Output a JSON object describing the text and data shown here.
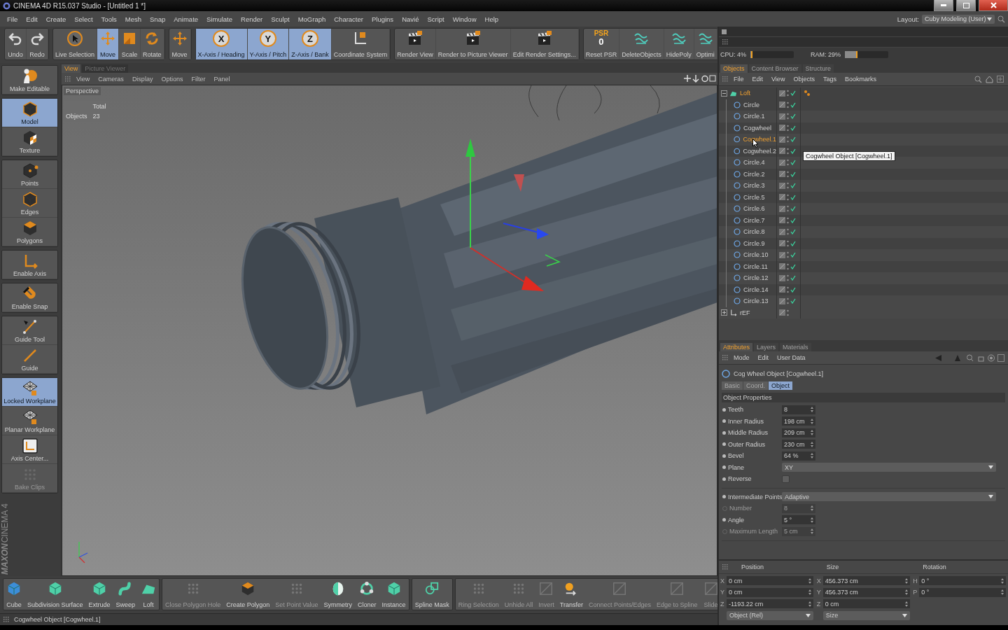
{
  "window": {
    "title": "CINEMA 4D R15.037 Studio - [Untitled 1 *]"
  },
  "menu": [
    "File",
    "Edit",
    "Create",
    "Select",
    "Tools",
    "Mesh",
    "Snap",
    "Animate",
    "Simulate",
    "Render",
    "Sculpt",
    "MoGraph",
    "Character",
    "Plugins",
    "Navié",
    "Script",
    "Window",
    "Help"
  ],
  "layout": {
    "label": "Layout:",
    "value": "Cuby Modeling (User)"
  },
  "toolbar": [
    [
      {
        "label": "Undo",
        "selected": false
      },
      {
        "label": "Redo",
        "selected": false
      }
    ],
    [
      {
        "label": "Live Selection",
        "selected": false
      },
      {
        "label": "Move",
        "selected": true
      },
      {
        "label": "Scale",
        "selected": false
      },
      {
        "label": "Rotate",
        "selected": false
      }
    ],
    [
      {
        "label": "Move",
        "selected": false
      }
    ],
    [
      {
        "label": "X-Axis / Heading",
        "selected": true,
        "glyph": "X"
      },
      {
        "label": "Y-Axis / Pitch",
        "selected": true,
        "glyph": "Y"
      },
      {
        "label": "Z-Axis / Bank",
        "selected": true,
        "glyph": "Z"
      },
      {
        "label": "Coordinate System",
        "selected": false
      }
    ],
    [
      {
        "label": "Render View",
        "selected": false
      },
      {
        "label": "Render to Picture Viewer",
        "selected": false
      },
      {
        "label": "Edit Render Settings...",
        "selected": false
      }
    ],
    [
      {
        "label": "Reset PSR",
        "selected": false,
        "glyph": "PSR",
        "glyph2": "0"
      },
      {
        "label": "DeleteObjects",
        "selected": false
      },
      {
        "label": "HidePoly",
        "selected": false
      },
      {
        "label": "Optimi",
        "selected": false
      }
    ]
  ],
  "meters": [
    {
      "label": "CPU: 4%",
      "level": 0.04
    },
    {
      "label": "RAM: 29%",
      "level": 0.29
    }
  ],
  "palette": [
    [
      {
        "label": "Make Editable",
        "selected": false,
        "disabled": false
      }
    ],
    [
      {
        "label": "Model",
        "selected": true,
        "disabled": false
      },
      {
        "label": "Texture",
        "selected": false,
        "disabled": false
      }
    ],
    [
      {
        "label": "Points",
        "selected": false,
        "disabled": false
      },
      {
        "label": "Edges",
        "selected": false,
        "disabled": false
      },
      {
        "label": "Polygons",
        "selected": false,
        "disabled": false
      }
    ],
    [
      {
        "label": "Enable Axis",
        "selected": false,
        "disabled": false
      }
    ],
    [
      {
        "label": "Enable Snap",
        "selected": false,
        "disabled": false
      }
    ],
    [
      {
        "label": "Guide Tool",
        "selected": false,
        "disabled": false
      },
      {
        "label": "Guide",
        "selected": false,
        "disabled": false
      }
    ],
    [
      {
        "label": "Locked Workplane",
        "selected": true,
        "disabled": false
      },
      {
        "label": "Planar Workplane",
        "selected": false,
        "disabled": false
      },
      {
        "label": "Axis Center...",
        "selected": false,
        "disabled": false
      },
      {
        "label": "Bake Clips",
        "selected": false,
        "disabled": true
      }
    ]
  ],
  "logo": {
    "brand": "MAXON",
    "product": "CINEMA 4"
  },
  "viewport": {
    "tabs": [
      {
        "label": "View",
        "selected": true
      },
      {
        "label": "Picture Viewer",
        "selected": false
      }
    ],
    "menu": [
      "View",
      "Cameras",
      "Display",
      "Options",
      "Filter",
      "Panel"
    ],
    "camera": "Perspective",
    "stats": {
      "header": "Total",
      "label": "Objects",
      "value": "23"
    }
  },
  "objects": {
    "tabs": [
      {
        "label": "Objects",
        "selected": true
      },
      {
        "label": "Content Browser",
        "selected": false
      },
      {
        "label": "Structure",
        "selected": false
      }
    ],
    "menu": [
      "File",
      "Edit",
      "View",
      "Objects",
      "Tags",
      "Bookmarks"
    ],
    "tree": [
      {
        "name": "Loft",
        "selected": true,
        "expanded": true,
        "checked": true,
        "children": [
          {
            "name": "Circle",
            "selected": false,
            "checked": true
          },
          {
            "name": "Circle.1",
            "selected": false,
            "checked": true
          },
          {
            "name": "Cogwheel",
            "selected": false,
            "checked": true
          },
          {
            "name": "Cogwheel.1",
            "selected": true,
            "checked": true
          },
          {
            "name": "Cogwheel.2",
            "selected": false,
            "checked": true
          },
          {
            "name": "Circle.4",
            "selected": false,
            "checked": true
          },
          {
            "name": "Circle.2",
            "selected": false,
            "checked": true
          },
          {
            "name": "Circle.3",
            "selected": false,
            "checked": true
          },
          {
            "name": "Circle.5",
            "selected": false,
            "checked": true
          },
          {
            "name": "Circle.6",
            "selected": false,
            "checked": true
          },
          {
            "name": "Circle.7",
            "selected": false,
            "checked": true
          },
          {
            "name": "Circle.8",
            "selected": false,
            "checked": true
          },
          {
            "name": "Circle.9",
            "selected": false,
            "checked": true
          },
          {
            "name": "Circle.10",
            "selected": false,
            "checked": true
          },
          {
            "name": "Circle.11",
            "selected": false,
            "checked": true
          },
          {
            "name": "Circle.12",
            "selected": false,
            "checked": true
          },
          {
            "name": "Circle.14",
            "selected": false,
            "checked": true
          },
          {
            "name": "Circle.13",
            "selected": false,
            "checked": true
          }
        ]
      },
      {
        "name": "rEF",
        "selected": false,
        "expanded": false,
        "checked": false
      }
    ],
    "tooltip": "Cogwheel Object [Cogwheel.1]"
  },
  "attributes": {
    "tabs": [
      {
        "label": "Attributes",
        "selected": true
      },
      {
        "label": "Layers",
        "selected": false
      },
      {
        "label": "Materials",
        "selected": false
      }
    ],
    "menu": [
      "Mode",
      "Edit",
      "User Data"
    ],
    "title": "Cog Wheel Object [Cogwheel.1]",
    "subtabs": [
      {
        "label": "Basic",
        "selected": false
      },
      {
        "label": "Coord.",
        "selected": false
      },
      {
        "label": "Object",
        "selected": true
      }
    ],
    "section": "Object Properties",
    "properties": [
      [
        {
          "label": "Teeth",
          "kind": "number",
          "value": "8",
          "disabled": false
        },
        {
          "label": "Inner Radius",
          "kind": "number",
          "value": "198 cm",
          "disabled": false
        },
        {
          "label": "Middle Radius",
          "kind": "number",
          "value": "209 cm",
          "disabled": false
        },
        {
          "label": "Outer Radius",
          "kind": "number",
          "value": "230 cm",
          "disabled": false
        },
        {
          "label": "Bevel",
          "kind": "number",
          "value": "64 %",
          "disabled": false
        },
        {
          "label": "Plane",
          "kind": "dropdown",
          "value": "XY",
          "disabled": false
        },
        {
          "label": "Reverse",
          "kind": "checkbox",
          "checked": false,
          "disabled": false
        }
      ],
      [
        {
          "label": "Intermediate Points",
          "kind": "dropdown",
          "value": "Adaptive",
          "disabled": false
        },
        {
          "label": "Number",
          "kind": "number",
          "value": "8",
          "disabled": true
        },
        {
          "label": "Angle",
          "kind": "number",
          "value": "5 °",
          "disabled": false
        },
        {
          "label": "Maximum Length",
          "kind": "number",
          "value": "5 cm",
          "disabled": true
        }
      ]
    ]
  },
  "coordinates": {
    "columns": [
      {
        "header": "Position",
        "fields": [
          {
            "axis": "X",
            "value": "0 cm"
          },
          {
            "axis": "Y",
            "value": "0 cm"
          },
          {
            "axis": "Z",
            "value": "-1193.22 cm"
          }
        ],
        "mode": "Object (Rel)"
      },
      {
        "header": "Size",
        "fields": [
          {
            "axis": "X",
            "value": "456.373 cm"
          },
          {
            "axis": "Y",
            "value": "456.373 cm"
          },
          {
            "axis": "Z",
            "value": "0 cm"
          }
        ],
        "mode": "Size"
      },
      {
        "header": "Rotation",
        "fields": [
          {
            "axis": "H",
            "value": "0 °"
          },
          {
            "axis": "P",
            "value": "0 °"
          }
        ]
      }
    ]
  },
  "bottom_toolbar": [
    [
      {
        "label": "Cube",
        "disabled": false
      },
      {
        "label": "Subdivision Surface",
        "disabled": false
      },
      {
        "label": "Extrude",
        "disabled": false
      },
      {
        "label": "Sweep",
        "disabled": false
      },
      {
        "label": "Loft",
        "disabled": false
      }
    ],
    [
      {
        "label": "Close Polygon Hole",
        "disabled": true
      },
      {
        "label": "Create Polygon",
        "disabled": false
      },
      {
        "label": "Set Point Value",
        "disabled": true
      },
      {
        "label": "Symmetry",
        "disabled": false
      },
      {
        "label": "Cloner",
        "disabled": false
      },
      {
        "label": "Instance",
        "disabled": false
      }
    ],
    [
      {
        "label": "Spline Mask",
        "disabled": false
      }
    ],
    [
      {
        "label": "Ring Selection",
        "disabled": true
      },
      {
        "label": "Unhide All",
        "disabled": true
      },
      {
        "label": "Invert",
        "disabled": true
      },
      {
        "label": "Transfer",
        "disabled": false
      },
      {
        "label": "Connect Points/Edges",
        "disabled": true
      },
      {
        "label": "Edge to Spline",
        "disabled": true
      },
      {
        "label": "Slide",
        "disabled": true
      }
    ]
  ],
  "status_bar": "Cogwheel Object [Cogwheel.1]"
}
